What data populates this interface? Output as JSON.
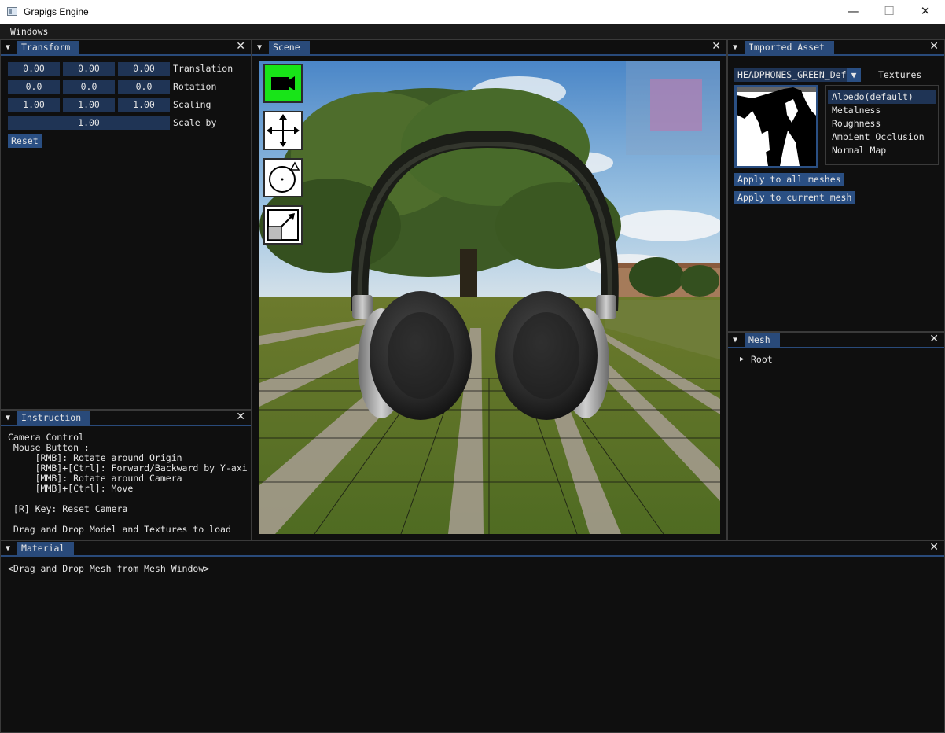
{
  "app": {
    "title": "Grapigs Engine"
  },
  "window_controls": {
    "minimize": "—",
    "maximize": "☐",
    "close": "✕"
  },
  "menubar": {
    "windows": "Windows"
  },
  "transform": {
    "title": "Transform",
    "translation": {
      "x": "0.00",
      "y": "0.00",
      "z": "0.00",
      "label": "Translation"
    },
    "rotation": {
      "x": "0.0",
      "y": "0.0",
      "z": "0.0",
      "label": "Rotation"
    },
    "scaling": {
      "x": "1.00",
      "y": "1.00",
      "z": "1.00",
      "label": "Scaling"
    },
    "scale_by": {
      "value": "1.00",
      "label": "Scale by"
    },
    "reset": "Reset"
  },
  "instruction": {
    "title": "Instruction",
    "lines": [
      "Camera Control",
      " Mouse Button :",
      "     [RMB]: Rotate around Origin",
      "     [RMB]+[Ctrl]: Forward/Backward by Y-axi",
      "     [MMB]: Rotate around Camera",
      "     [MMB]+[Ctrl]: Move",
      "",
      " [R] Key: Reset Camera",
      "",
      " Drag and Drop Model and Textures to load"
    ]
  },
  "scene": {
    "title": "Scene",
    "tools": [
      "camera-tool",
      "move-tool",
      "rotate-tool",
      "scale-tool"
    ],
    "active_tool_color": "#18e418"
  },
  "imported_asset": {
    "title": "Imported Asset",
    "selected_asset": "HEADPHONES_GREEN_Defau",
    "textures_label": "Textures",
    "texture_types": [
      "Albedo(default)",
      "Metalness",
      "Roughness",
      "Ambient Occlusion",
      "Normal Map"
    ],
    "selected_texture": "Albedo(default)",
    "apply_all": "Apply to all meshes",
    "apply_current": "Apply to current mesh"
  },
  "mesh": {
    "title": "Mesh",
    "root": "Root"
  },
  "material": {
    "title": "Material",
    "hint": "<Drag and Drop Mesh from Mesh Window>"
  },
  "colors": {
    "accent": "#294a7a",
    "field": "#1f3455",
    "button": "#2a4f83",
    "background": "#0f0f0f"
  }
}
